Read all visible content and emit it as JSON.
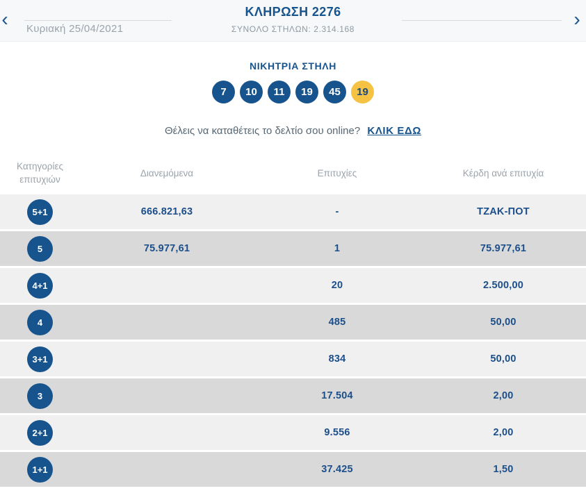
{
  "colors": {
    "accent_blue": "#17548e",
    "joker_yellow": "#f5c243",
    "row_light": "#f0f0f0",
    "row_dark": "#d9d9d9"
  },
  "icons": {
    "prev_arrow": "‹",
    "next_arrow": "›"
  },
  "header": {
    "title": "ΚΛΗΡΩΣΗ 2276",
    "subtitle": "ΣΥΝΟΛΟ ΣΤΗΛΩΝ: 2.314.168",
    "date": "Κυριακή 25/04/2021"
  },
  "winning": {
    "title": "ΝΙΚΗΤΡΙΑ ΣΤΗΛΗ",
    "numbers": [
      "7",
      "10",
      "11",
      "19",
      "45"
    ],
    "joker": "19"
  },
  "cta": {
    "question": "Θέλεις να καταθέτεις το δελτίο σου online?",
    "link_label": "ΚΛΙΚ ΕΔΩ"
  },
  "table": {
    "headers": {
      "category_line1": "Κατηγορίες",
      "category_line2": "επιτυχιών",
      "distributed": "Διανεμόμενα",
      "wins": "Επιτυχίες",
      "prize": "Κέρδη ανά επιτυχία"
    },
    "rows": [
      {
        "badge": "5+1",
        "distributed": "666.821,63",
        "wins": "-",
        "prize": "ΤΖΑΚ-ΠΟΤ"
      },
      {
        "badge": "5",
        "distributed": "75.977,61",
        "wins": "1",
        "prize": "75.977,61"
      },
      {
        "badge": "4+1",
        "distributed": "",
        "wins": "20",
        "prize": "2.500,00"
      },
      {
        "badge": "4",
        "distributed": "",
        "wins": "485",
        "prize": "50,00"
      },
      {
        "badge": "3+1",
        "distributed": "",
        "wins": "834",
        "prize": "50,00"
      },
      {
        "badge": "3",
        "distributed": "",
        "wins": "17.504",
        "prize": "2,00"
      },
      {
        "badge": "2+1",
        "distributed": "",
        "wins": "9.556",
        "prize": "2,00"
      },
      {
        "badge": "1+1",
        "distributed": "",
        "wins": "37.425",
        "prize": "1,50"
      }
    ]
  }
}
